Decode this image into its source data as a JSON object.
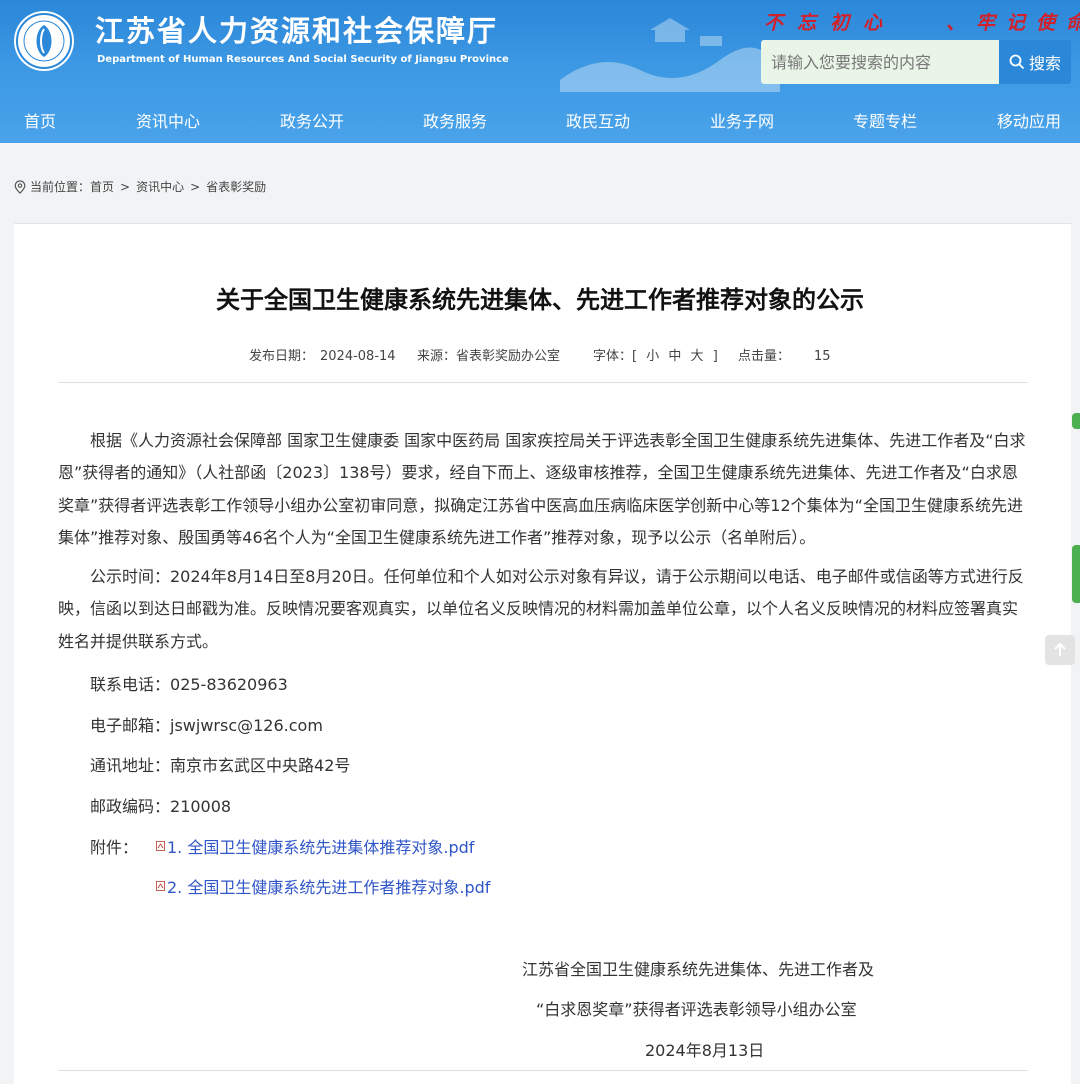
{
  "header": {
    "title": "江苏省人力资源和社会保障厅",
    "subtitle": "Department of Human Resources And Social Security of Jiangsu Province",
    "slogan_left": "不忘初心",
    "slogan_right": "、牢记使命",
    "search_placeholder": "请输入您要搜索的内容",
    "search_label": "搜索"
  },
  "nav": [
    "首页",
    "资讯中心",
    "政务公开",
    "政务服务",
    "政民互动",
    "业务子网",
    "专题专栏",
    "移动应用"
  ],
  "breadcrumb": {
    "label": "当前位置：",
    "items": [
      "首页",
      "资讯中心",
      "省表彰奖励"
    ],
    "sep": ">"
  },
  "article": {
    "title": "关于全国卫生健康系统先进集体、先进工作者推荐对象的公示",
    "meta": {
      "date_label": "发布日期：",
      "date": "2024-08-14",
      "source_label": "来源：",
      "source": "省表彰奖励办公室",
      "font_label": "字体：[",
      "font_small": "小",
      "font_medium": "中",
      "font_large": "大",
      "font_close": "]",
      "hits_label": "点击量：",
      "hits": "15"
    },
    "para1": "根据《人力资源社会保障部 国家卫生健康委 国家中医药局 国家疾控局关于评选表彰全国卫生健康系统先进集体、先进工作者及“白求恩”获得者的通知》（人社部函〔2023〕138号）要求，经自下而上、逐级审核推荐，全国卫生健康系统先进集体、先进工作者及“白求恩奖章”获得者评选表彰工作领导小组办公室初审同意，拟确定江苏省中医高血压病临床医学创新中心等12个集体为“全国卫生健康系统先进集体”推荐对象、殷国勇等46名个人为“全国卫生健康系统先进工作者”推荐对象，现予以公示（名单附后）。",
    "para2": "公示时间：2024年8月14日至8月20日。任何单位和个人如对公示对象有异议，请于公示期间以电话、电子邮件或信函等方式进行反映，信函以到达日邮戳为准。反映情况要客观真实，以单位名义反映情况的材料需加盖单位公章，以个人名义反映情况的材料应签署真实姓名并提供联系方式。",
    "contacts": [
      {
        "label": "联系电话：",
        "value": "025-83620963"
      },
      {
        "label": "电子邮箱：",
        "value": "jswjwrsc@126.com"
      },
      {
        "label": "通讯地址：",
        "value": "南京市玄武区中央路42号"
      },
      {
        "label": "邮政编码：",
        "value": "210008"
      }
    ],
    "attachments_label": "附件：",
    "attachments": [
      "1. 全国卫生健康系统先进集体推荐对象.pdf",
      "2. 全国卫生健康系统先进工作者推荐对象.pdf"
    ],
    "signature": [
      "江苏省全国卫生健康系统先进集体、先进工作者及",
      "“白求恩奖章”获得者评选表彰领导小组办公室",
      "2024年8月13日"
    ]
  },
  "colors": {
    "header_blue": "#3c98e3",
    "slogan_red": "#d2202a",
    "link_blue": "#2f55c7",
    "side_green": "#4caf50"
  }
}
